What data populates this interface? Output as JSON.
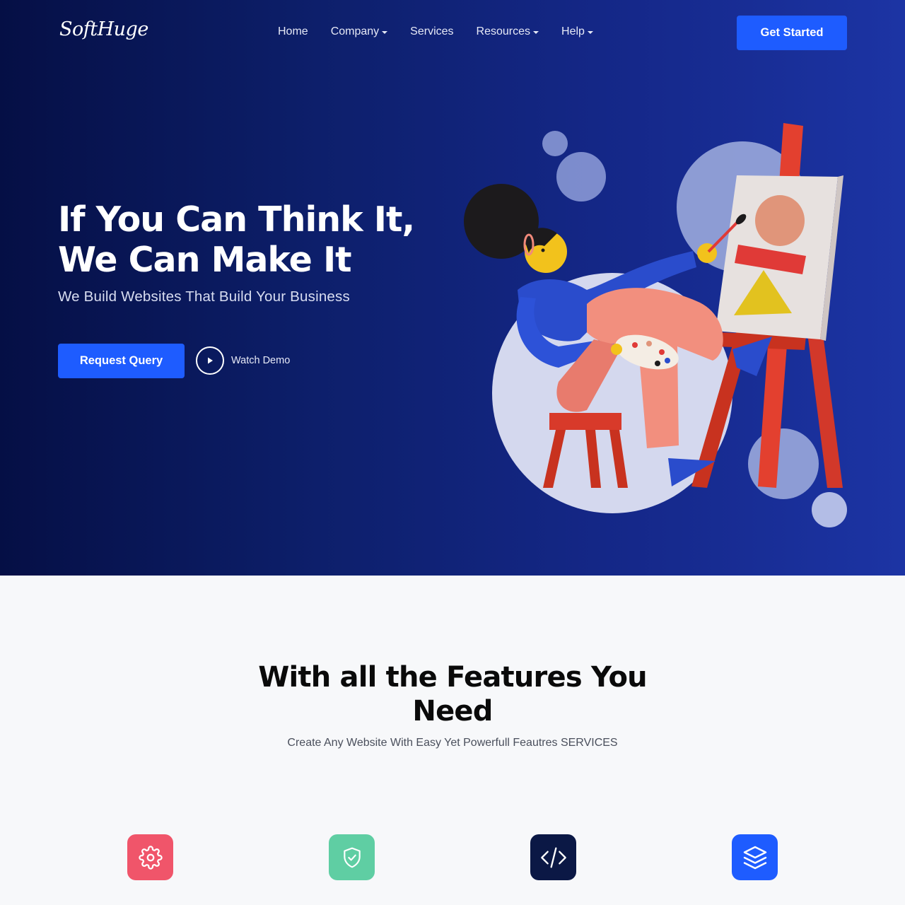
{
  "header": {
    "logo": "SoftHuge",
    "nav": [
      {
        "label": "Home",
        "dropdown": false
      },
      {
        "label": "Company",
        "dropdown": true
      },
      {
        "label": "Services",
        "dropdown": false
      },
      {
        "label": "Resources",
        "dropdown": true
      },
      {
        "label": "Help",
        "dropdown": true
      }
    ],
    "cta_label": "Get Started"
  },
  "hero": {
    "title_line1": "If You Can Think It,",
    "title_line2": "We Can Make It",
    "subtitle": "We Build Websites That Build Your Business",
    "primary_button": "Request Query",
    "secondary_button": "Watch Demo",
    "secondary_icon": "play-icon"
  },
  "features": {
    "title": "With all the Features You Need",
    "subtitle": "Create Any Website With Easy Yet Powerfull Feautres SERVICES",
    "icons": [
      {
        "icon": "gear-icon",
        "color": "#f0556a"
      },
      {
        "icon": "shield-check-icon",
        "color": "#5fcea3"
      },
      {
        "icon": "code-icon",
        "color": "#0b1845"
      },
      {
        "icon": "layers-icon",
        "color": "#1e5cff"
      }
    ]
  },
  "colors": {
    "accent": "#1e5cff",
    "hero_dark": "#050f45",
    "hero_light": "#1c34a4"
  }
}
